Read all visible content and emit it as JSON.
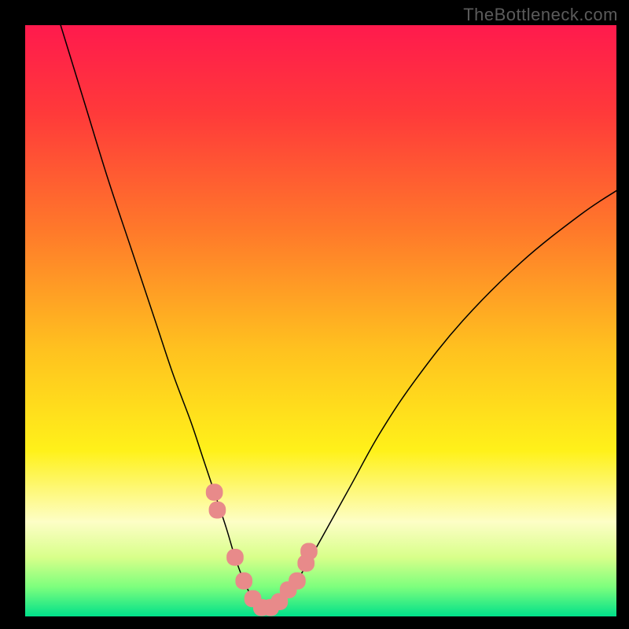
{
  "watermark": "TheBottleneck.com",
  "chart_data": {
    "type": "line",
    "title": "",
    "xlabel": "",
    "ylabel": "",
    "xlim": [
      0,
      100
    ],
    "ylim": [
      0,
      100
    ],
    "grid": false,
    "legend": null,
    "background_gradient": {
      "type": "rainbow_vertical",
      "stops": [
        {
          "offset": 0.0,
          "color": "#ff1a4d"
        },
        {
          "offset": 0.15,
          "color": "#ff3a3a"
        },
        {
          "offset": 0.35,
          "color": "#ff7a2a"
        },
        {
          "offset": 0.55,
          "color": "#ffc21f"
        },
        {
          "offset": 0.72,
          "color": "#fff11a"
        },
        {
          "offset": 0.84,
          "color": "#fdfec6"
        },
        {
          "offset": 0.9,
          "color": "#d8ff8a"
        },
        {
          "offset": 0.95,
          "color": "#7dff7d"
        },
        {
          "offset": 1.0,
          "color": "#00e08a"
        }
      ]
    },
    "series": [
      {
        "name": "bottleneck-curve",
        "color": "#000000",
        "stroke_width": 1.5,
        "x": [
          6,
          10,
          14,
          18,
          22,
          25,
          28,
          30,
          32,
          34,
          35.5,
          37,
          38.5,
          40,
          42,
          44,
          46,
          50,
          55,
          60,
          66,
          74,
          84,
          94,
          100
        ],
        "y": [
          100,
          87,
          74,
          62,
          50,
          41,
          33,
          27,
          21,
          15,
          10,
          6,
          3,
          1.5,
          1.5,
          3,
          6,
          13,
          22,
          31,
          40,
          50,
          60,
          68,
          72
        ]
      }
    ],
    "marker_points": {
      "name": "threshold-markers",
      "color": "#e88a8a",
      "x": [
        32,
        32.5,
        35.5,
        37,
        38.5,
        40,
        41.5,
        43,
        44.5,
        46,
        47.5,
        48
      ],
      "y": [
        21,
        18,
        10,
        6,
        3,
        1.5,
        1.5,
        2.5,
        4.5,
        6,
        9,
        11
      ],
      "r_data": 1.6
    }
  }
}
